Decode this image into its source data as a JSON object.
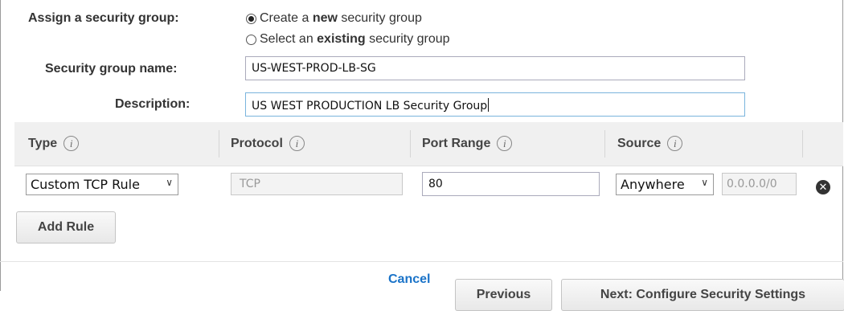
{
  "form": {
    "assign_label": "Assign a security group:",
    "option_new_pre": "Create a ",
    "option_new_bold": "new",
    "option_new_post": " security group",
    "option_existing_pre": "Select an ",
    "option_existing_bold": "existing",
    "option_existing_post": " security group",
    "name_label": "Security group name:",
    "name_value": "US-WEST-PROD-LB-SG",
    "desc_label": "Description:",
    "desc_value": "US WEST PRODUCTION LB Security Group"
  },
  "table": {
    "headers": [
      "Type",
      "Protocol",
      "Port Range",
      "Source"
    ],
    "info_glyph": "i",
    "row": {
      "type": "Custom TCP Rule",
      "protocol": "TCP",
      "port_range": "80",
      "source": "Anywhere",
      "cidr": "0.0.0.0/0"
    }
  },
  "buttons": {
    "add_rule": "Add Rule",
    "cancel": "Cancel",
    "previous": "Previous",
    "next": "Next: Configure Security Settings"
  },
  "icons": {
    "radio": "radio-icon",
    "info": "info-icon",
    "chevron": "chevron-down-icon",
    "remove": "remove-icon"
  },
  "colors": {
    "link": "#1a73c8",
    "focus_border": "#7ab4dd",
    "header_bg": "#f0f0f0"
  }
}
